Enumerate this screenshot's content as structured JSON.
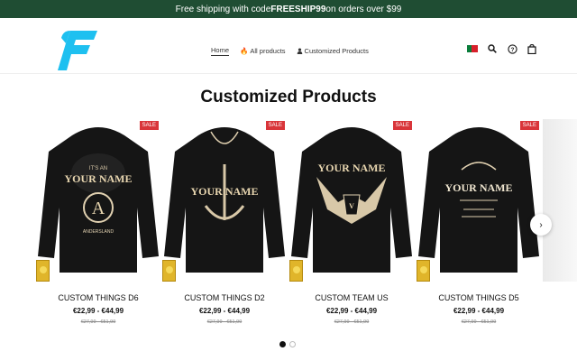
{
  "promo": {
    "prefix": "Free shipping with code ",
    "code": "FREESHIP99",
    "suffix": " on orders over $99"
  },
  "nav": [
    {
      "label": "Home",
      "icon": null
    },
    {
      "label": "All products",
      "icon": "fire-icon"
    },
    {
      "label": "Customized Products",
      "icon": "user-icon"
    }
  ],
  "header_actions": {
    "flag": "portugal-flag-icon",
    "search": "search-icon",
    "help": "help-circle-icon",
    "cart": "shopping-bag-icon"
  },
  "section": {
    "title": "Customized Products"
  },
  "products": [
    {
      "name": "CUSTOM THINGS D6",
      "price": "€22,99 - €44,99",
      "old_price": "€27,99 - €51,99",
      "sale": "SALE",
      "text1": "YOUR NAME",
      "text2": "ANDERSLAND"
    },
    {
      "name": "CUSTOM THINGS D2",
      "price": "€22,99 - €44,99",
      "old_price": "€27,99 - €51,99",
      "sale": "SALE",
      "text1": "YOUR NAME",
      "text2": ""
    },
    {
      "name": "CUSTOM TEAM US",
      "price": "€22,99 - €44,99",
      "old_price": "€27,99 - €51,99",
      "sale": "SALE",
      "text1": "YOUR NAME",
      "text2": ""
    },
    {
      "name": "CUSTOM THINGS D5",
      "price": "€22,99 - €44,99",
      "old_price": "€27,99 - €51,99",
      "sale": "SALE",
      "text1": "YOUR NAME",
      "text2": ""
    }
  ],
  "carousel": {
    "next": "›",
    "pages": 2,
    "active": 0
  },
  "colors": {
    "promo_bg": "#1f4d33",
    "sale_bg": "#d9353a",
    "logo": "#1ec0f0",
    "hoodie": "#151515"
  }
}
